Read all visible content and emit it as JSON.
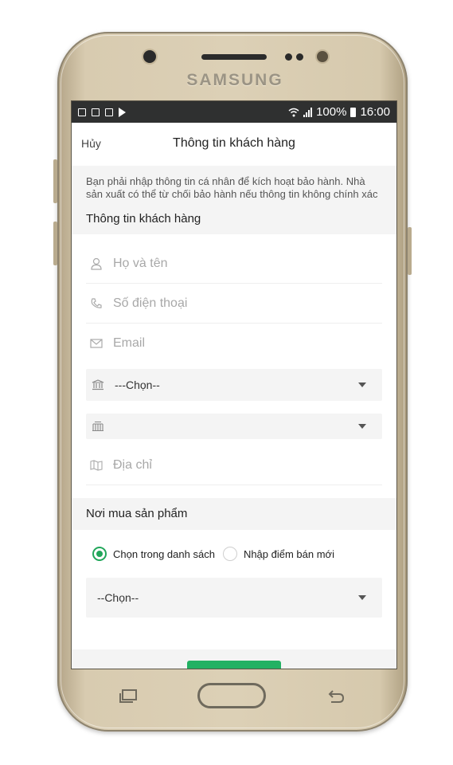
{
  "device": {
    "brand": "SAMSUNG"
  },
  "statusbar": {
    "battery": "100%",
    "time": "16:00"
  },
  "header": {
    "cancel_label": "Hủy",
    "title": "Thông tin khách hàng"
  },
  "notice": "Bạn phải nhập thông tin cá nhân để kích hoạt bảo hành. Nhà sản xuất có thể từ chối bảo hành nếu thông tin không chính xác",
  "customer_section": {
    "title": "Thông tin khách hàng",
    "name_placeholder": "Họ và tên",
    "phone_placeholder": "Số điện thoại",
    "email_placeholder": "Email",
    "province_value": "---Chọn--",
    "district_value": "",
    "address_placeholder": "Địa chỉ"
  },
  "purchase_section": {
    "title": "Nơi mua sản phẩm",
    "option_list": "Chọn trong danh sách",
    "option_new": "Nhập điểm bán mới",
    "store_value": "--Chọn--"
  },
  "colors": {
    "accent": "#21a65a",
    "section_bg": "#f4f4f4",
    "statusbar": "#2f3030"
  }
}
